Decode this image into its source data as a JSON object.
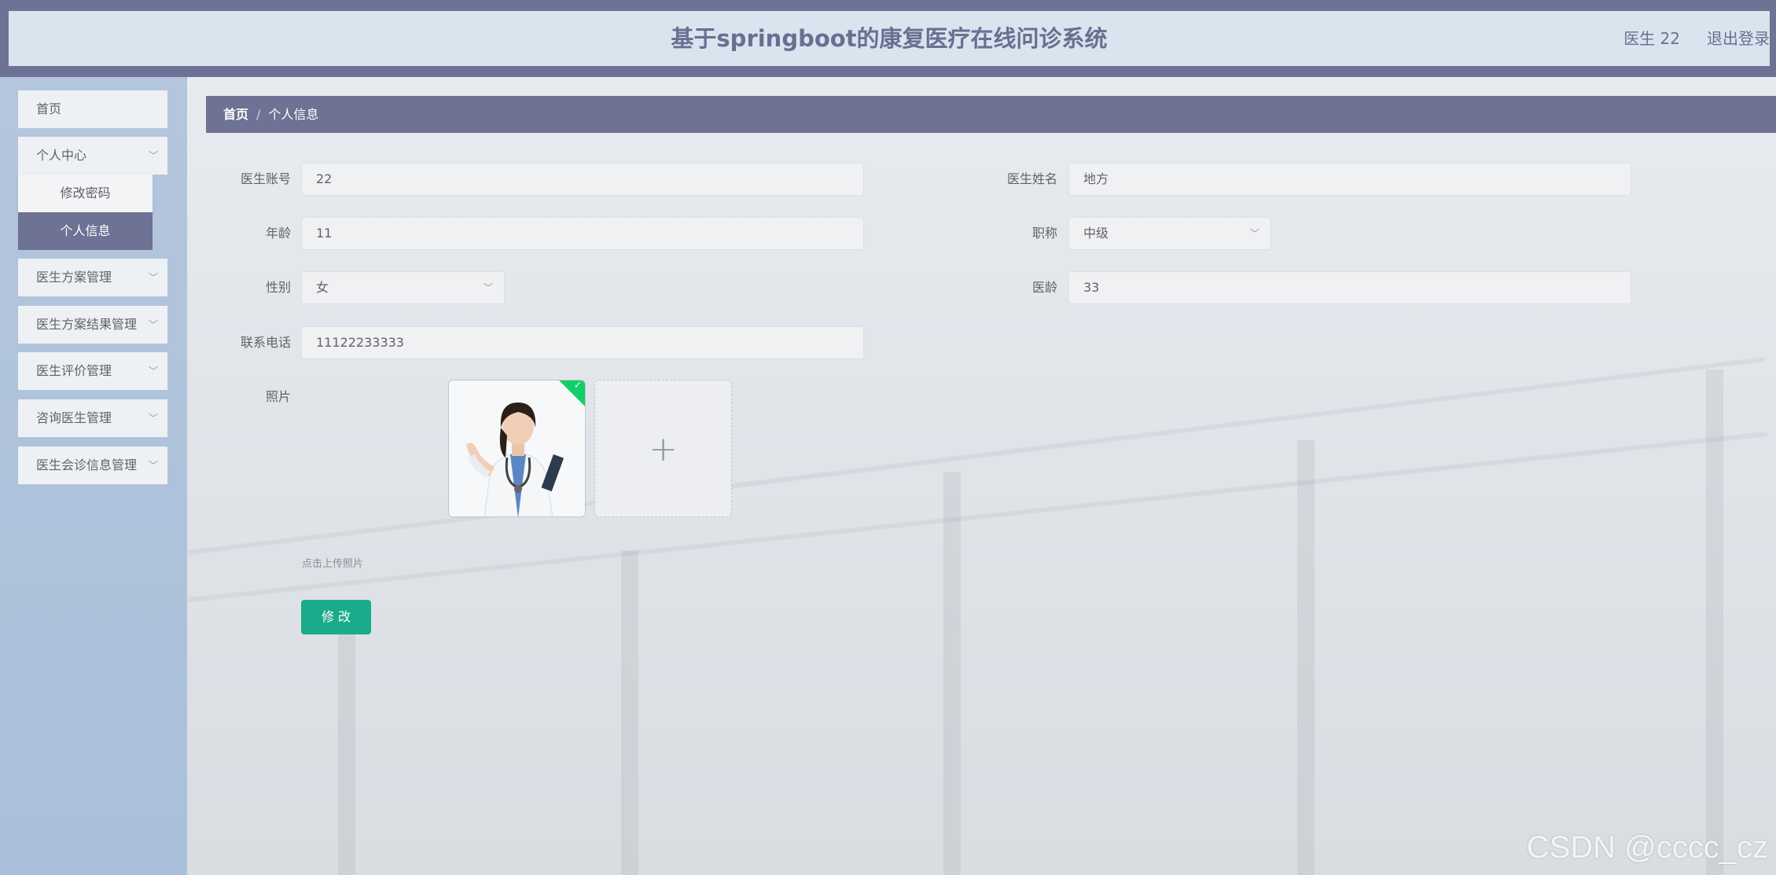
{
  "header": {
    "title": "基于springboot的康复医疗在线问诊系统",
    "user": "医生 22",
    "logout": "退出登录"
  },
  "sidebar": {
    "items": [
      {
        "label": "首页"
      },
      {
        "label": "个人中心"
      },
      {
        "label": "医生方案管理"
      },
      {
        "label": "医生方案结果管理"
      },
      {
        "label": "医生评价管理"
      },
      {
        "label": "咨询医生管理"
      },
      {
        "label": "医生会诊信息管理"
      }
    ],
    "submenu": [
      {
        "label": "修改密码"
      },
      {
        "label": "个人信息",
        "active": true
      }
    ]
  },
  "breadcrumb": {
    "home": "首页",
    "separator": "/",
    "current": "个人信息"
  },
  "form": {
    "account_label": "医生账号",
    "account_value": "22",
    "name_label": "医生姓名",
    "name_value": "地方",
    "age_label": "年龄",
    "age_value": "11",
    "title_label": "职称",
    "title_value": "中级",
    "gender_label": "性别",
    "gender_value": "女",
    "seniority_label": "医龄",
    "seniority_value": "33",
    "phone_label": "联系电话",
    "phone_value": "11122233333",
    "photo_label": "照片",
    "upload_hint": "点击上传照片",
    "submit_label": "修 改"
  },
  "watermark": "CSDN @cccc_cz",
  "icons": {
    "chevron": "chevron-down-icon",
    "plus": "plus-icon",
    "check": "check-icon"
  },
  "colors": {
    "accent": "#6e7294",
    "submit": "#1aab8a",
    "success": "#13ce66"
  }
}
